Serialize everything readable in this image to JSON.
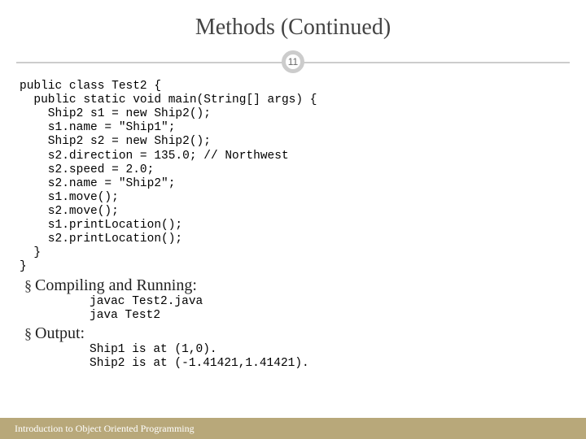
{
  "title": "Methods (Continued)",
  "page_number": "11",
  "code_block": "public class Test2 {\n  public static void main(String[] args) {\n    Ship2 s1 = new Ship2();\n    s1.name = \"Ship1\";\n    Ship2 s2 = new Ship2();\n    s2.direction = 135.0; // Northwest\n    s2.speed = 2.0;\n    s2.name = \"Ship2\";\n    s1.move();\n    s2.move();\n    s1.printLocation();\n    s2.printLocation();\n  }\n}",
  "compile": {
    "bullet": "§",
    "label": "Compiling and Running:",
    "code": "javac Test2.java\njava Test2"
  },
  "output": {
    "bullet": "§",
    "label": "Output:",
    "code": "Ship1 is at (1,0).\nShip2 is at (-1.41421,1.41421)."
  },
  "footer": "Introduction to Object Oriented Programming"
}
